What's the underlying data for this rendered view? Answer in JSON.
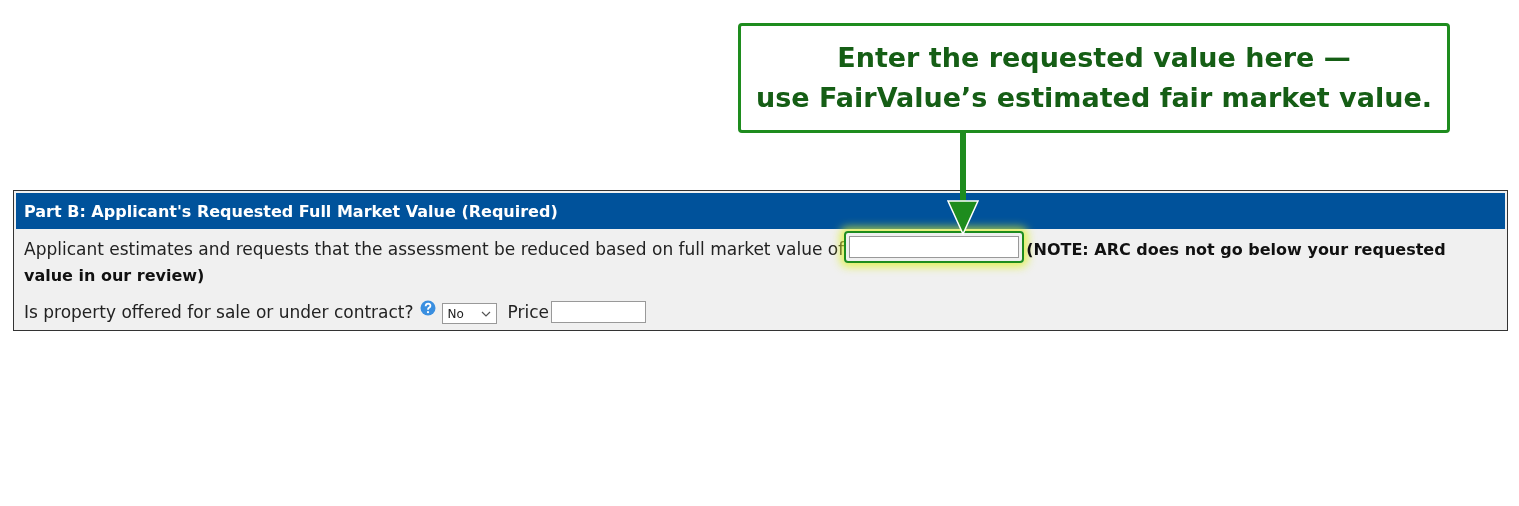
{
  "callout": {
    "lines": [
      "Enter the requested value here —",
      "use FairValue’s estimated fair market value."
    ]
  },
  "panel": {
    "title": "Part B: Applicant's Requested Full Market Value (Required)",
    "value_row": {
      "label": "Applicant estimates and requests that the assessment be reduced based on full market value of",
      "field": {
        "highlighted": true
      },
      "note_lines": [
        "(NOTE: ARC does not go below your requested",
        "value in our review)"
      ]
    },
    "sale_row": {
      "question": "Is property offered for sale or under contract?",
      "select": {
        "value": "No"
      },
      "price_label": "Price"
    }
  }
}
